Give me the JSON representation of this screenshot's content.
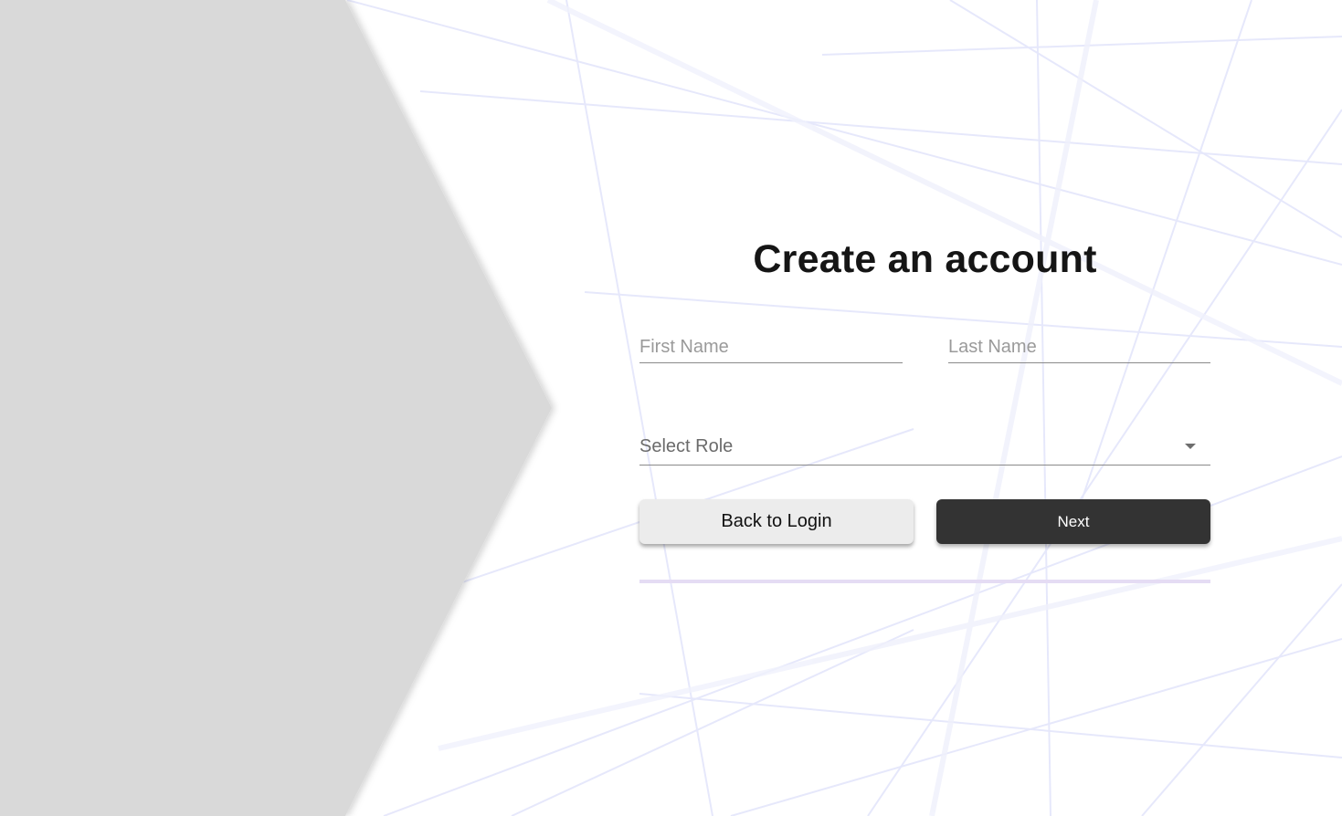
{
  "page": {
    "title": "Create an account"
  },
  "form": {
    "first_name": {
      "placeholder": "First Name",
      "value": ""
    },
    "last_name": {
      "placeholder": "Last Name",
      "value": ""
    },
    "role_select": {
      "label": "Select Role"
    },
    "back_button_label": "Back to Login",
    "next_button_label": "Next",
    "progress": 0
  },
  "colors": {
    "side_panel": "#d9d9d9",
    "primary_button": "#333333",
    "secondary_button": "#ececec",
    "progress_track": "#e5dcf4"
  },
  "icons": {
    "role_select": "caret-down-icon"
  }
}
